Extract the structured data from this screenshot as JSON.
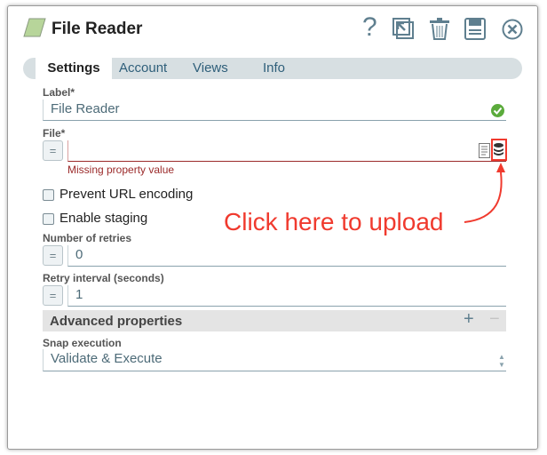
{
  "header": {
    "title": "File Reader",
    "buttons": [
      "help-icon",
      "export-icon",
      "trash-icon",
      "save-icon",
      "close-icon"
    ]
  },
  "tabs": [
    {
      "label": "Settings",
      "active": true
    },
    {
      "label": "Account"
    },
    {
      "label": "Views"
    },
    {
      "label": "Info"
    }
  ],
  "fields": {
    "label": {
      "label": "Label*",
      "value": "File Reader"
    },
    "file": {
      "label": "File*",
      "value": "",
      "error": "Missing property value"
    },
    "prevent_url": {
      "label": "Prevent URL encoding",
      "checked": false
    },
    "staging": {
      "label": "Enable staging",
      "checked": false
    },
    "retries": {
      "label": "Number of retries",
      "value": "0"
    },
    "interval": {
      "label": "Retry interval (seconds)",
      "value": "1"
    },
    "advanced": {
      "label": "Advanced properties"
    },
    "snap_exec": {
      "label": "Snap execution",
      "value": "Validate & Execute"
    }
  },
  "annotation": {
    "text": "Click here to upload",
    "color": "#f03a2e"
  },
  "eq_label": "="
}
